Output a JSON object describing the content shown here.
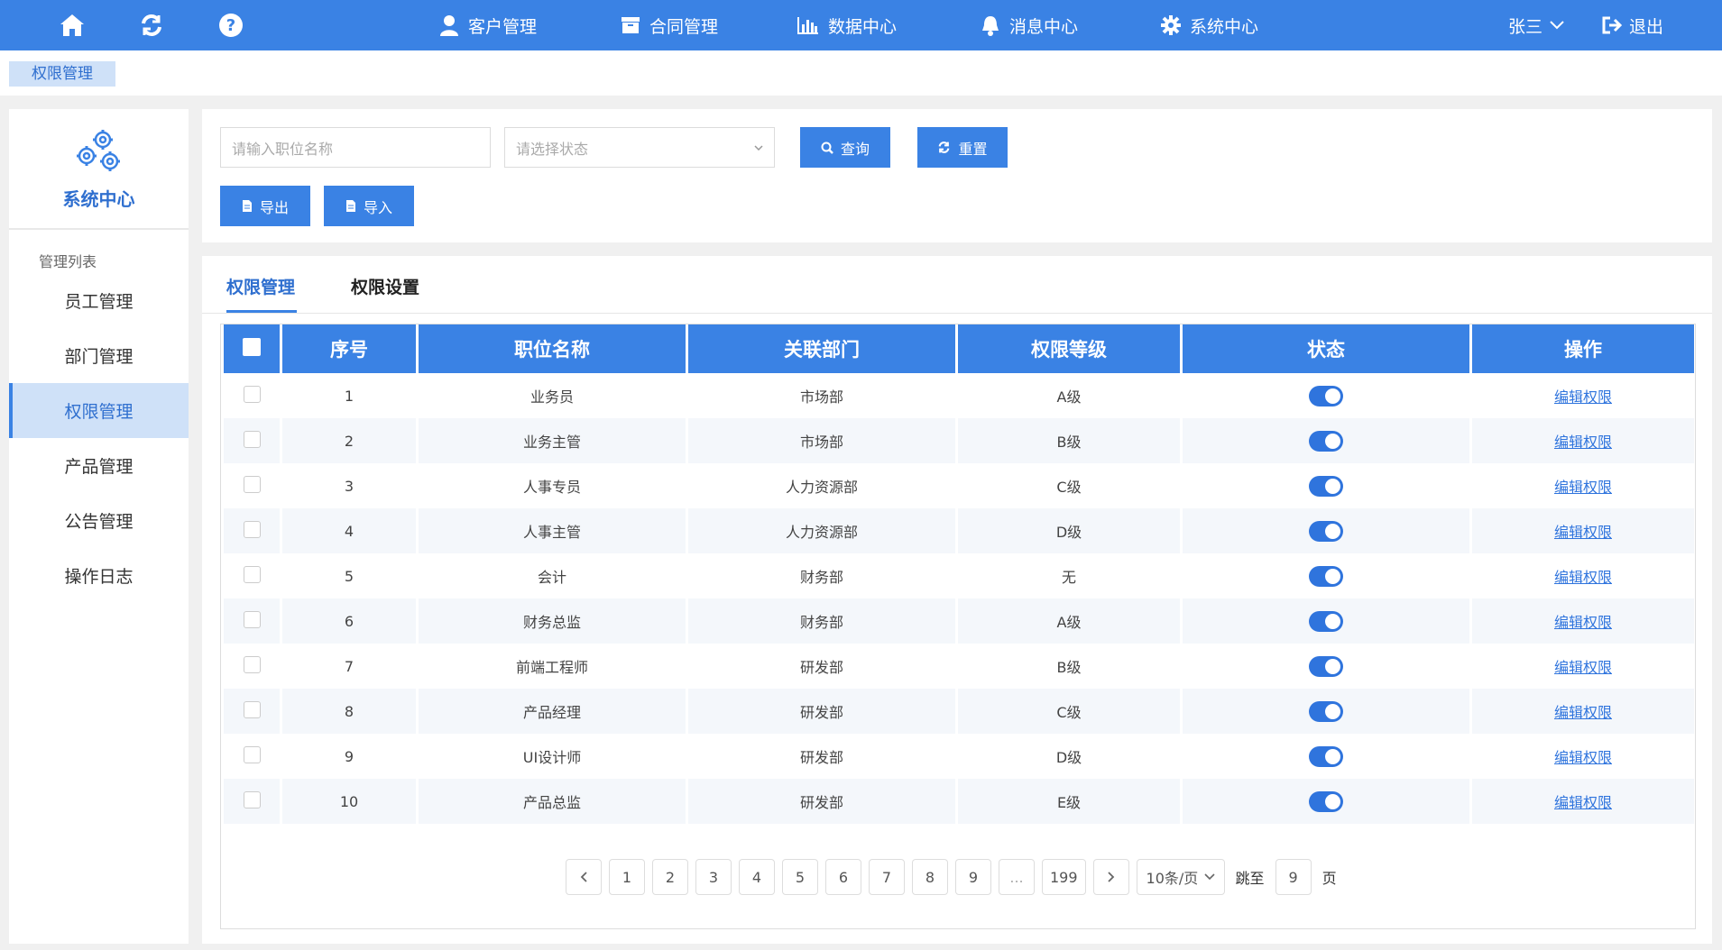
{
  "topbar": {
    "quick_icons": [
      "home-icon",
      "refresh-icon",
      "help-icon"
    ],
    "nav": [
      {
        "label": "客户管理",
        "icon": "user-icon"
      },
      {
        "label": "合同管理",
        "icon": "archive-icon"
      },
      {
        "label": "数据中心",
        "icon": "bar-chart-icon"
      },
      {
        "label": "消息中心",
        "icon": "bell-icon"
      },
      {
        "label": "系统中心",
        "icon": "gear-icon"
      }
    ],
    "user": "张三",
    "logout": "退出"
  },
  "breadcrumb": "权限管理",
  "sidebar": {
    "title": "系统中心",
    "section": "管理列表",
    "items": [
      "员工管理",
      "部门管理",
      "权限管理",
      "产品管理",
      "公告管理",
      "操作日志"
    ],
    "active_index": 2
  },
  "filter": {
    "position_placeholder": "请输入职位名称",
    "status_placeholder": "请选择状态",
    "search_label": "查询",
    "reset_label": "重置",
    "export_label": "导出",
    "import_label": "导入"
  },
  "tabs": [
    "权限管理",
    "权限设置"
  ],
  "table": {
    "headers": [
      "序号",
      "职位名称",
      "关联部门",
      "权限等级",
      "状态",
      "操作"
    ],
    "rows": [
      {
        "no": "1",
        "position": "业务员",
        "dept": "市场部",
        "level": "A级",
        "status": true,
        "action": "编辑权限"
      },
      {
        "no": "2",
        "position": "业务主管",
        "dept": "市场部",
        "level": "B级",
        "status": true,
        "action": "编辑权限"
      },
      {
        "no": "3",
        "position": "人事专员",
        "dept": "人力资源部",
        "level": "C级",
        "status": true,
        "action": "编辑权限"
      },
      {
        "no": "4",
        "position": "人事主管",
        "dept": "人力资源部",
        "level": "D级",
        "status": true,
        "action": "编辑权限"
      },
      {
        "no": "5",
        "position": "会计",
        "dept": "财务部",
        "level": "无",
        "status": true,
        "action": "编辑权限"
      },
      {
        "no": "6",
        "position": "财务总监",
        "dept": "财务部",
        "level": "A级",
        "status": true,
        "action": "编辑权限"
      },
      {
        "no": "7",
        "position": "前端工程师",
        "dept": "研发部",
        "level": "B级",
        "status": true,
        "action": "编辑权限"
      },
      {
        "no": "8",
        "position": "产品经理",
        "dept": "研发部",
        "level": "C级",
        "status": true,
        "action": "编辑权限"
      },
      {
        "no": "9",
        "position": "UI设计师",
        "dept": "研发部",
        "level": "D级",
        "status": true,
        "action": "编辑权限"
      },
      {
        "no": "10",
        "position": "产品总监",
        "dept": "研发部",
        "level": "E级",
        "status": true,
        "action": "编辑权限"
      }
    ]
  },
  "pagination": {
    "pages": [
      "1",
      "2",
      "3",
      "4",
      "5",
      "6",
      "7",
      "8",
      "9",
      "...",
      "199"
    ],
    "page_size": "10条/页",
    "jump_label": "跳至",
    "jump_value": "9",
    "page_suffix": "页"
  },
  "colors": {
    "primary": "#3a82e4",
    "active_bg": "#cfe1f8",
    "link": "#2f74dd"
  }
}
